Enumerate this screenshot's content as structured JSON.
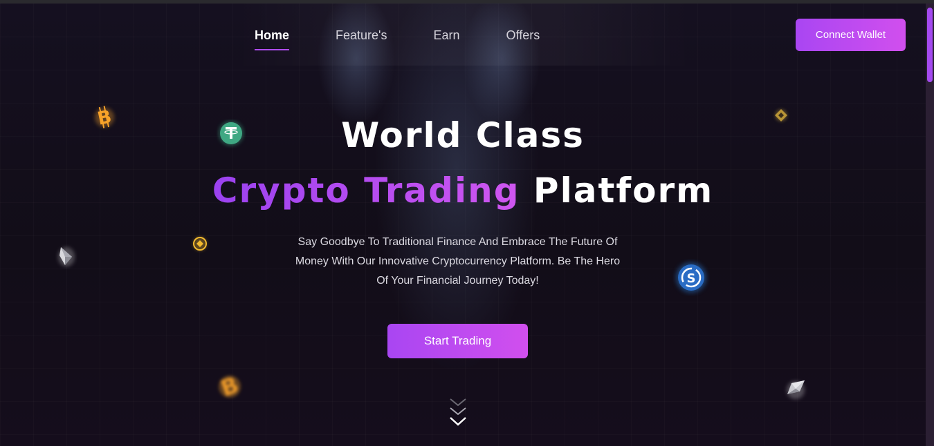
{
  "nav": {
    "items": [
      {
        "label": "Home",
        "active": true
      },
      {
        "label": "Feature's",
        "active": false
      },
      {
        "label": "Earn",
        "active": false
      },
      {
        "label": "Offers",
        "active": false
      }
    ],
    "connect_label": "Connect Wallet"
  },
  "hero": {
    "title_line1": "World Class",
    "title_line2_accent": "Crypto Trading",
    "title_line2_rest": "Platform",
    "subtitle": "Say Goodbye To Traditional Finance And Embrace The Future Of Money With Our Innovative Cryptocurrency Platform. Be The Hero Of Your Financial Journey Today!",
    "cta_label": "Start Trading"
  },
  "icons": {
    "scroll_down": "chevrons-down-icon",
    "coins": [
      "bitcoin-icon",
      "tether-icon",
      "binance-icon",
      "ethereum-icon",
      "usdc-icon",
      "ethereum-icon"
    ]
  },
  "colors": {
    "background": "#120d18",
    "accent_start": "#a946f2",
    "accent_end": "#d14fee",
    "text_muted": "#dcdae2"
  }
}
